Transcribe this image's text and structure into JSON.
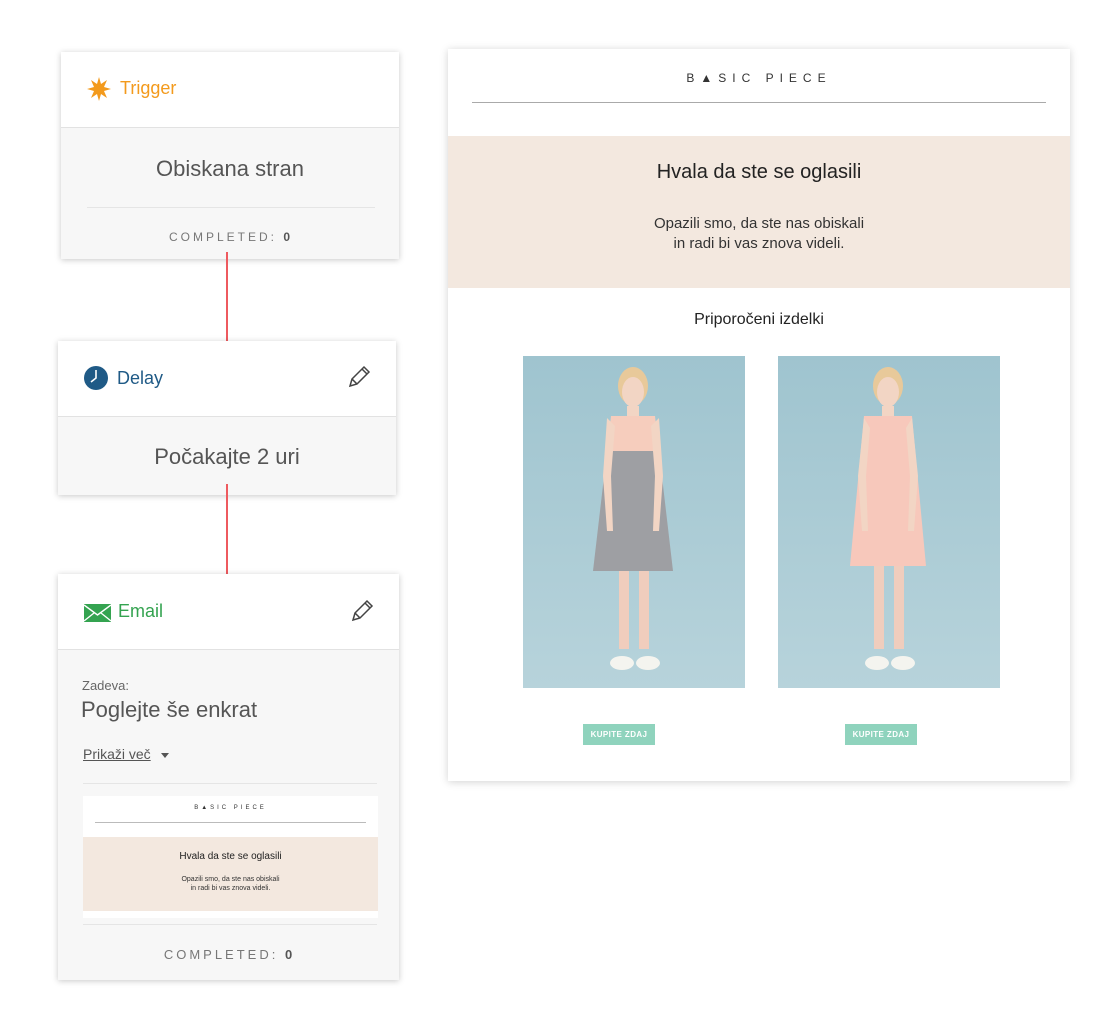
{
  "trigger_card": {
    "label": "Trigger",
    "title": "Obiskana stran",
    "completed_label": "COMPLETED:",
    "completed_count": "0"
  },
  "delay_card": {
    "label": "Delay",
    "title": "Počakajte 2 uri"
  },
  "email_card": {
    "label": "Email",
    "subject_label": "Zadeva:",
    "subject": "Poglejte še enkrat",
    "show_more": "Prikaži več",
    "completed_label": "COMPLETED:",
    "completed_count": "0",
    "thumbnail": {
      "brand": "B▲SIC PIECE",
      "heading": "Hvala da ste se oglasili",
      "line1": "Opazili smo, da ste nas obiskali",
      "line2": "in radi bi vas znova videli."
    }
  },
  "email_preview": {
    "brand": "B▲SIC PIECE",
    "heading": "Hvala da ste se oglasili",
    "line1": "Opazili smo, da ste nas obiskali",
    "line2": "in radi bi vas znova videli.",
    "section_title": "Priporočeni izdelki",
    "products": [
      {
        "button": "KUPITE ZDAJ",
        "dress": "grey-pink dress"
      },
      {
        "button": "KUPITE ZDAJ",
        "dress": "pink dress"
      }
    ]
  },
  "colors": {
    "trigger": "#f39a1c",
    "delay": "#1f5a86",
    "email": "#34a350",
    "arrow": "#ee5a5f",
    "banner": "#f3e8df",
    "button": "#8fd3bd",
    "photo_bg": "#a9cbd4"
  },
  "icons": {
    "trigger": "starburst-icon",
    "delay": "clock-icon",
    "email": "envelope-icon",
    "edit": "pencil-icon",
    "dropdown": "caret-down-icon"
  }
}
